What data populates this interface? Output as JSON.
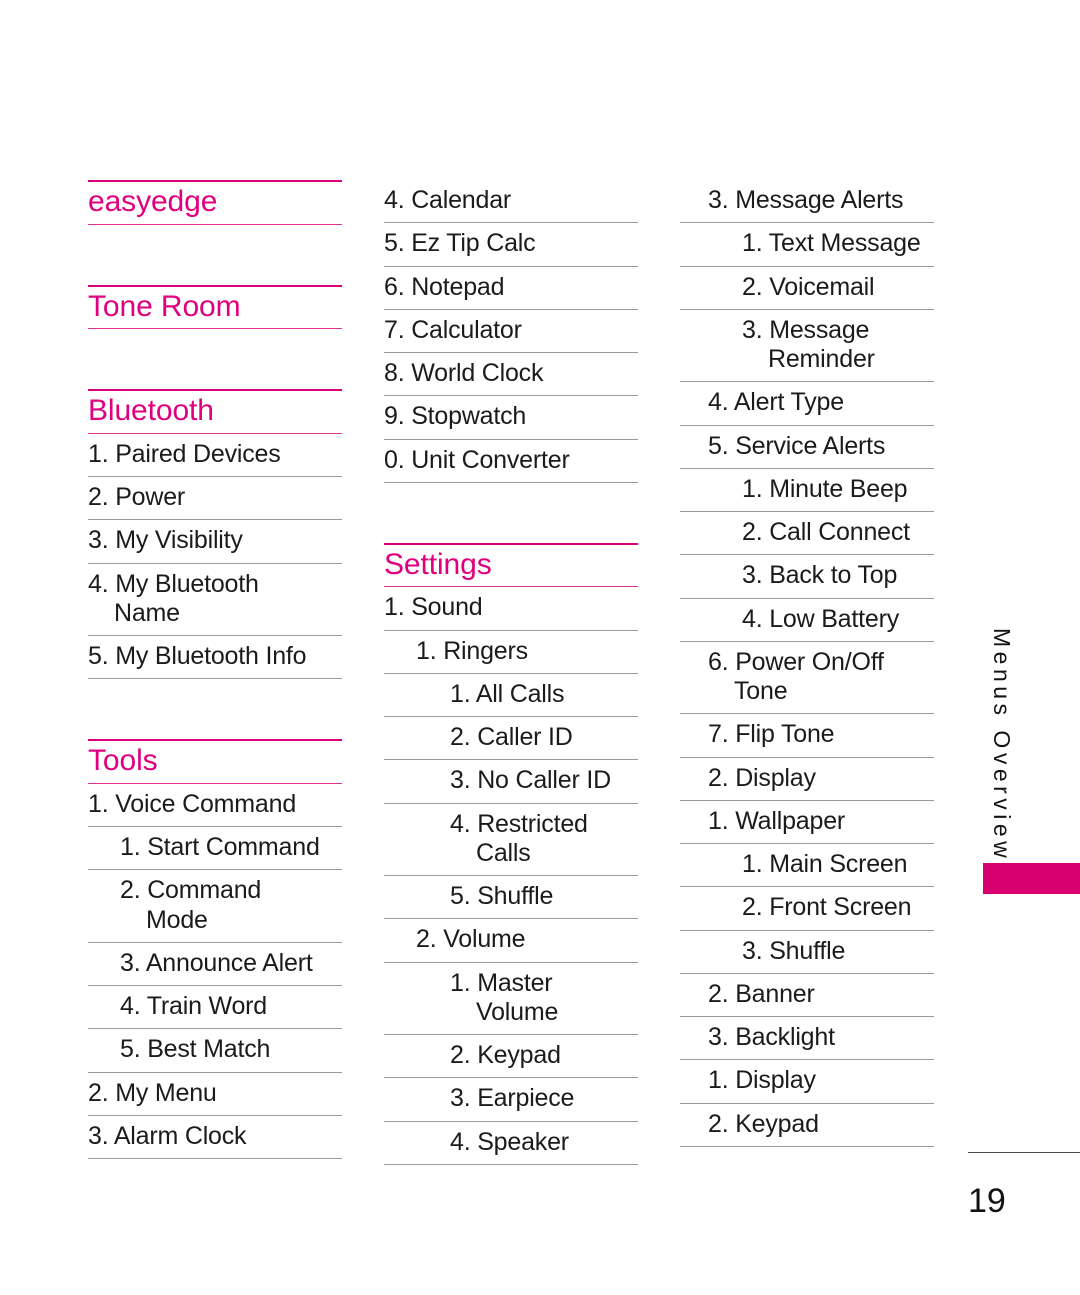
{
  "document": {
    "page_number": "19",
    "side_tab_label": "Menus Overview",
    "accent_color": "#E0007F",
    "tab_color": "#D8006E",
    "rule_color": "#9a9a9a"
  },
  "columns": [
    {
      "id": "column-left",
      "blocks": [
        {
          "type": "heading-only",
          "title": "easyedge",
          "items": []
        },
        {
          "type": "heading-only",
          "title": "Tone Room",
          "items": []
        },
        {
          "type": "section",
          "title": "Bluetooth",
          "items": [
            {
              "level": 0,
              "text": "1. Paired Devices"
            },
            {
              "level": 0,
              "text": "2. Power"
            },
            {
              "level": 0,
              "text": "3. My Visibility"
            },
            {
              "level": 0,
              "text": "4. My Bluetooth",
              "text2": "Name"
            },
            {
              "level": 0,
              "text": "5. My Bluetooth Info"
            }
          ]
        },
        {
          "type": "section",
          "title": "Tools",
          "items": [
            {
              "level": 0,
              "text": "1. Voice Command"
            },
            {
              "level": 1,
              "text": "1. Start Command"
            },
            {
              "level": 1,
              "text": "2. Command",
              "text2": "Mode"
            },
            {
              "level": 1,
              "text": "3. Announce Alert"
            },
            {
              "level": 1,
              "text": "4. Train Word"
            },
            {
              "level": 1,
              "text": "5. Best Match"
            },
            {
              "level": 0,
              "text": "2. My Menu"
            },
            {
              "level": 0,
              "text": "3. Alarm Clock"
            }
          ]
        }
      ]
    },
    {
      "id": "column-middle",
      "blocks": [
        {
          "type": "list-continuation",
          "title": "",
          "items": [
            {
              "level": 0,
              "text": "4. Calendar"
            },
            {
              "level": 0,
              "text": "5. Ez Tip Calc"
            },
            {
              "level": 0,
              "text": "6. Notepad"
            },
            {
              "level": 0,
              "text": "7. Calculator"
            },
            {
              "level": 0,
              "text": "8. World Clock"
            },
            {
              "level": 0,
              "text": "9. Stopwatch"
            },
            {
              "level": 0,
              "text": "0. Unit Converter"
            }
          ]
        },
        {
          "type": "section",
          "title": "Settings",
          "items": [
            {
              "level": 0,
              "text": "1. Sound"
            },
            {
              "level": 1,
              "text": "1. Ringers"
            },
            {
              "level": 2,
              "text": "1. All Calls"
            },
            {
              "level": 2,
              "text": "2. Caller ID"
            },
            {
              "level": 2,
              "text": "3. No Caller ID"
            },
            {
              "level": 2,
              "text": "4. Restricted",
              "text2": "Calls"
            },
            {
              "level": 2,
              "text": "5. Shuffle"
            },
            {
              "level": 1,
              "text": "2. Volume"
            },
            {
              "level": 2,
              "text": "1. Master",
              "text2": "Volume"
            },
            {
              "level": 2,
              "text": "2. Keypad"
            },
            {
              "level": 2,
              "text": "3. Earpiece"
            },
            {
              "level": 2,
              "text": "4. Speaker"
            }
          ]
        }
      ]
    },
    {
      "id": "column-right",
      "blocks": [
        {
          "type": "list-continuation",
          "title": "",
          "items": [
            {
              "level": 0,
              "text": "3. Message Alerts"
            },
            {
              "level": 1,
              "text": "1. Text Message"
            },
            {
              "level": 1,
              "text": "2. Voicemail"
            },
            {
              "level": 1,
              "text": "3. Message",
              "text2": "Reminder"
            },
            {
              "level": 0,
              "text": "4. Alert Type"
            },
            {
              "level": 0,
              "text": "5. Service Alerts"
            },
            {
              "level": 1,
              "text": "1. Minute Beep"
            },
            {
              "level": 1,
              "text": "2. Call Connect"
            },
            {
              "level": 1,
              "text": "3. Back to Top"
            },
            {
              "level": 1,
              "text": "4. Low Battery"
            },
            {
              "level": 0,
              "text": "6. Power On/Off",
              "text2": "Tone"
            },
            {
              "level": 0,
              "text": "7. Flip Tone"
            },
            {
              "level": 0,
              "text": "2. Display",
              "outdent": true
            },
            {
              "level": 0,
              "text": "1. Wallpaper"
            },
            {
              "level": 1,
              "text": "1. Main Screen"
            },
            {
              "level": 1,
              "text": "2. Front Screen"
            },
            {
              "level": 1,
              "text": "3. Shuffle"
            },
            {
              "level": 0,
              "text": "2. Banner",
              "outdent": true
            },
            {
              "level": 0,
              "text": "3. Backlight",
              "outdent": true
            },
            {
              "level": 0,
              "text": "1. Display"
            },
            {
              "level": 0,
              "text": "2. Keypad"
            }
          ]
        }
      ]
    }
  ]
}
